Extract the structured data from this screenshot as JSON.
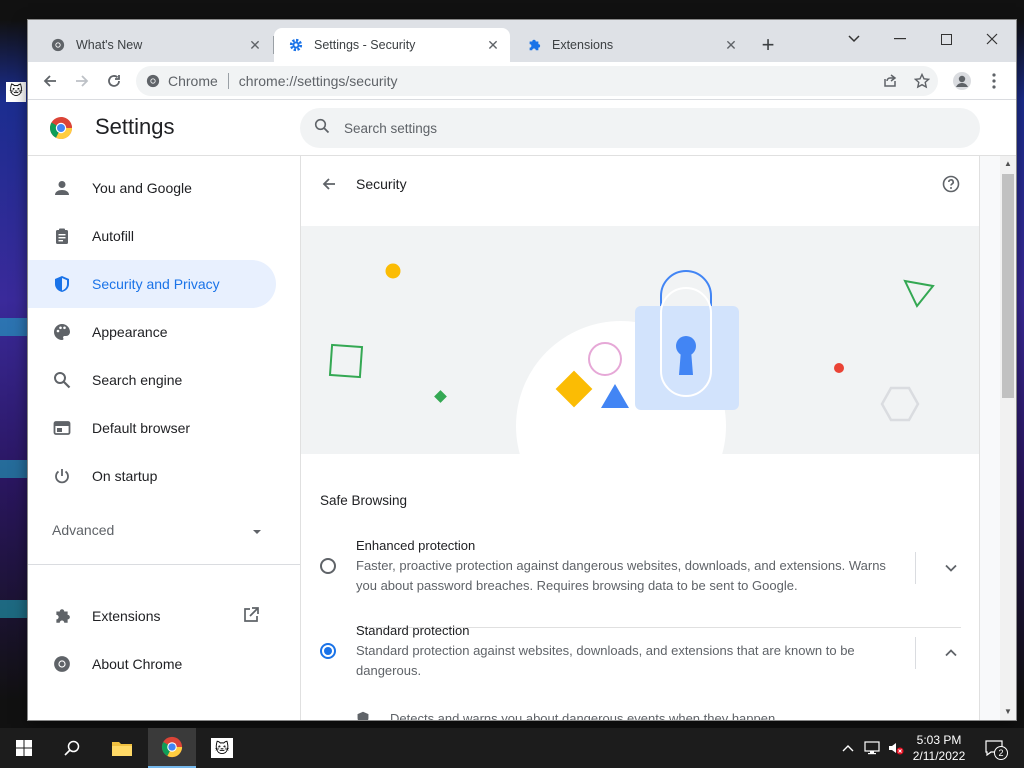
{
  "tabs": [
    {
      "title": "What's New",
      "icon": "chrome-icon",
      "active": false
    },
    {
      "title": "Settings - Security",
      "icon": "gear-icon",
      "active": true
    },
    {
      "title": "Extensions",
      "icon": "puzzle-icon",
      "active": false
    }
  ],
  "toolbar": {
    "site_chip": "Chrome",
    "url": "chrome://settings/security"
  },
  "settings": {
    "title": "Settings",
    "search_placeholder": "Search settings"
  },
  "sidebar": {
    "items": [
      {
        "label": "You and Google",
        "icon": "person-icon"
      },
      {
        "label": "Autofill",
        "icon": "clipboard-icon"
      },
      {
        "label": "Security and Privacy",
        "icon": "shield-icon",
        "selected": true
      },
      {
        "label": "Appearance",
        "icon": "palette-icon"
      },
      {
        "label": "Search engine",
        "icon": "search-icon"
      },
      {
        "label": "Default browser",
        "icon": "browser-icon"
      },
      {
        "label": "On startup",
        "icon": "power-icon"
      }
    ],
    "advanced_label": "Advanced",
    "bottom_items": [
      {
        "label": "Extensions",
        "icon": "puzzle-icon"
      },
      {
        "label": "About Chrome",
        "icon": "chrome-icon"
      }
    ]
  },
  "page": {
    "title": "Security",
    "section_label": "Safe Browsing",
    "options": [
      {
        "title": "Enhanced protection",
        "description": "Faster, proactive protection against dangerous websites, downloads, and extensions. Warns you about password breaches. Requires browsing data to be sent to Google.",
        "checked": false
      },
      {
        "title": "Standard protection",
        "description": "Standard protection against websites, downloads, and extensions that are known to be dangerous.",
        "checked": true
      }
    ],
    "sub_item": "Detects and warns you about dangerous events when they happen"
  },
  "taskbar": {
    "time": "5:03 PM",
    "date": "2/11/2022",
    "notification_count": "2"
  },
  "colors": {
    "accent": "#1a73e8",
    "selected_bg": "#e8f0fe"
  }
}
